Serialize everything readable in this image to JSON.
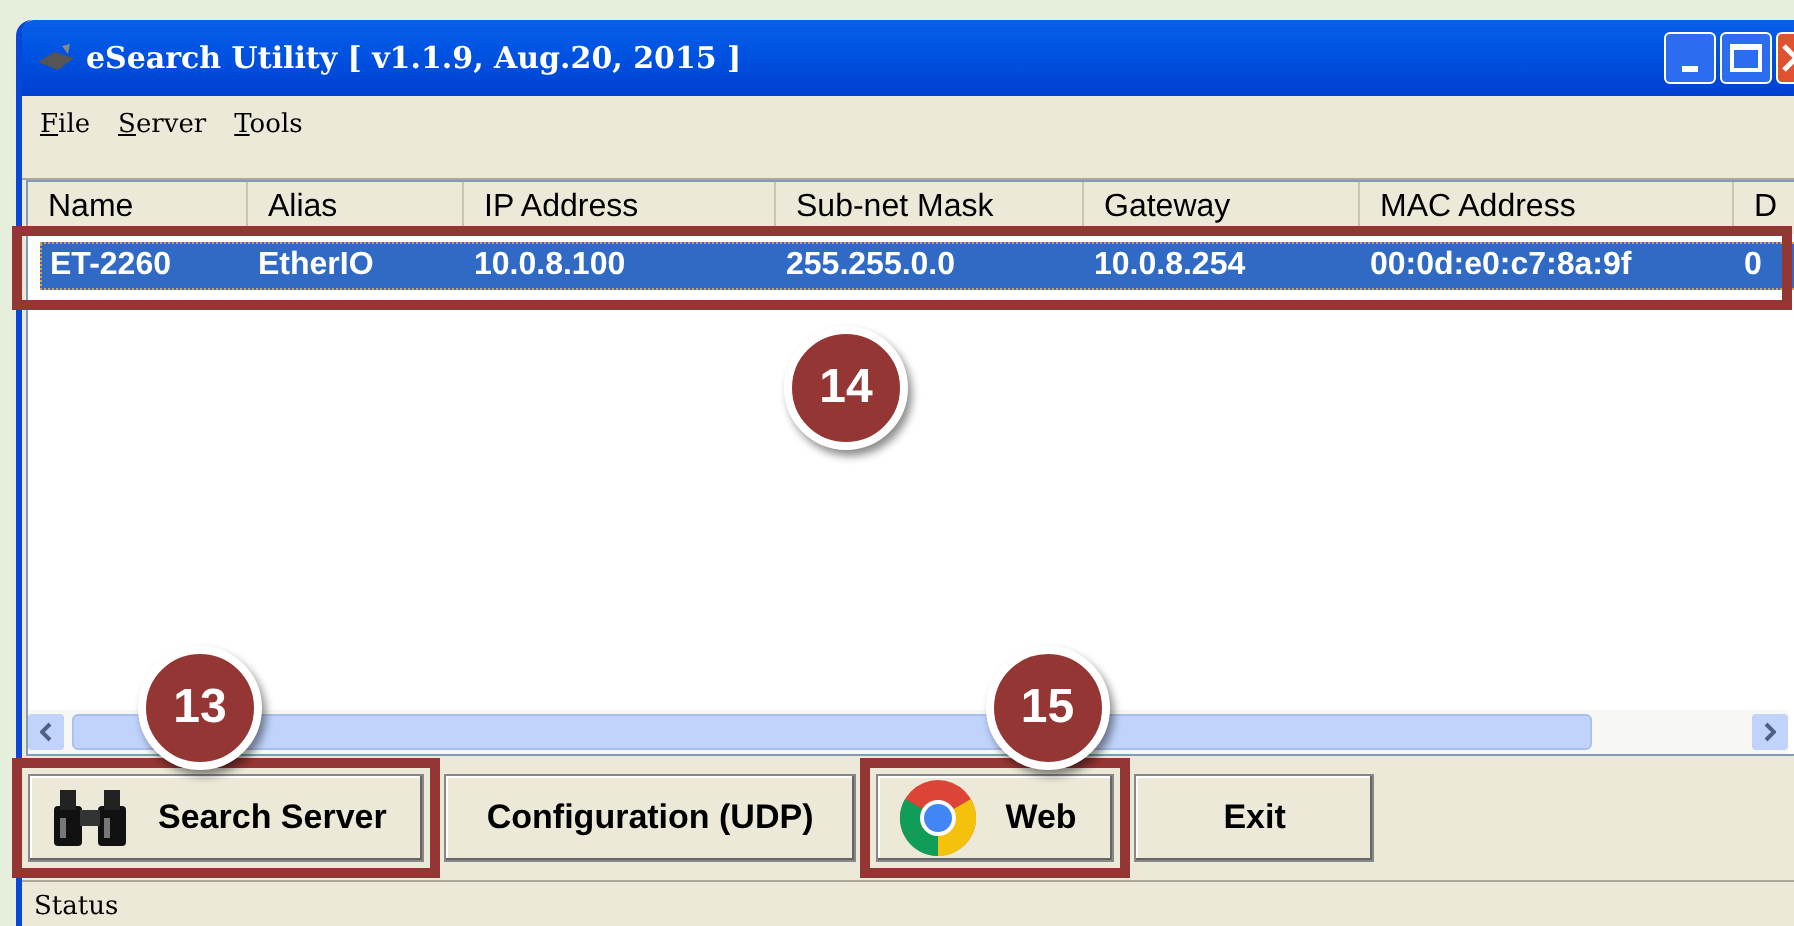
{
  "window": {
    "title": "eSearch Utility [ v1.1.9, Aug.20, 2015 ]"
  },
  "menu": [
    {
      "label": "File"
    },
    {
      "label": "Server"
    },
    {
      "label": "Tools"
    }
  ],
  "table": {
    "columns": [
      "Name",
      "Alias",
      "IP Address",
      "Sub-net Mask",
      "Gateway",
      "MAC Address",
      "D"
    ],
    "rows": [
      {
        "cells": [
          "ET-2260",
          "EtherIO",
          "10.0.8.100",
          "255.255.0.0",
          "10.0.8.254",
          "00:0d:e0:c7:8a:9f",
          "0"
        ],
        "selected": true,
        "callout": "14"
      }
    ]
  },
  "buttons": [
    {
      "label": "Search Server",
      "kind": "search",
      "callout": "13"
    },
    {
      "label": "Configuration (UDP)",
      "kind": "text"
    },
    {
      "label": "Web",
      "kind": "web",
      "callout": "15"
    },
    {
      "label": "Exit",
      "kind": "text"
    }
  ],
  "status_bar": {
    "text": "Status"
  }
}
